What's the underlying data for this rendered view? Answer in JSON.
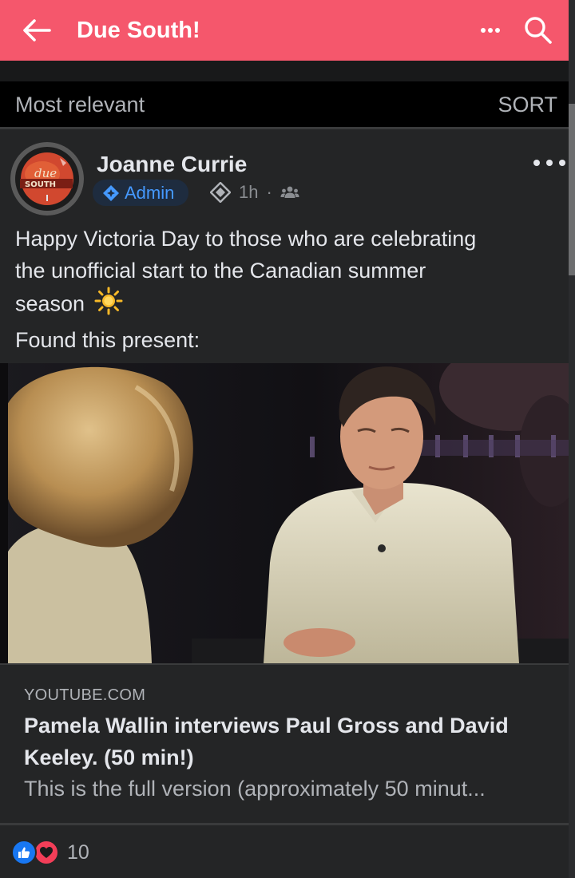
{
  "header": {
    "title": "Due South!",
    "back_icon": "arrow-left-icon",
    "more_icon": "more-horizontal-icon",
    "search_icon": "search-icon",
    "accent": "#f5576c"
  },
  "sort_bar": {
    "label": "Most relevant",
    "sort_label": "SORT"
  },
  "post": {
    "author": "Joanne Currie",
    "avatar_text": "due SOUTH",
    "badge": "Admin",
    "time": "1h",
    "separator": "·",
    "audience_icon": "group-icon",
    "body_lines": [
      "Happy Victoria Day to those who are celebrating",
      "the unofficial start to the Canadian summer",
      "season",
      "Found this present:"
    ],
    "emoji_icon": "sun-icon",
    "link": {
      "domain": "YOUTUBE.COM",
      "title": "Pamela Wallin interviews Paul Gross and David Keeley. (50 min!)",
      "description": "This is the full version (approximately 50 minut..."
    },
    "reactions": {
      "icons": [
        "like-icon",
        "love-icon"
      ],
      "count": "10"
    }
  }
}
